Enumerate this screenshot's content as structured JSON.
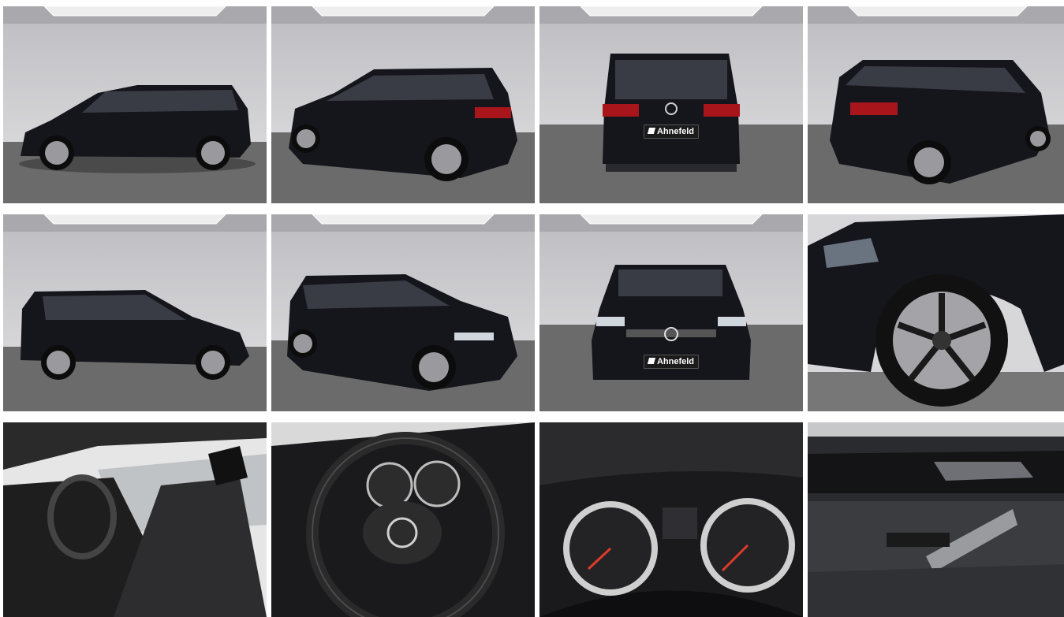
{
  "gallery": {
    "dealer_badge": "Ahnefeld",
    "images": [
      {
        "view": "side-left",
        "label": ""
      },
      {
        "view": "rear-three-quarter-left",
        "label": ""
      },
      {
        "view": "rear",
        "label": ""
      },
      {
        "view": "rear-three-quarter-right",
        "label": ""
      },
      {
        "view": "side-right",
        "label": ""
      },
      {
        "view": "front-three-quarter-right",
        "label": ""
      },
      {
        "view": "front",
        "label": ""
      },
      {
        "view": "wheel-detail",
        "label": ""
      },
      {
        "view": "interior-front-seats",
        "label": ""
      },
      {
        "view": "steering-wheel",
        "label": ""
      },
      {
        "view": "instrument-cluster",
        "label": ""
      },
      {
        "view": "door-panel",
        "label": ""
      }
    ]
  },
  "colors": {
    "studio_wall": "#cfcfd2",
    "studio_floor": "#6b6b6b",
    "car_body": "#15151c",
    "ceiling_light": "#f4f4f4"
  }
}
